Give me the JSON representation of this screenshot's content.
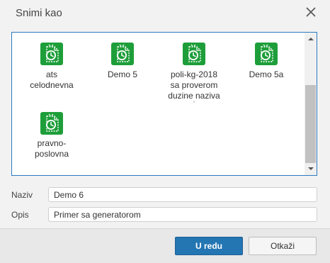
{
  "dialog": {
    "title": "Snimi kao",
    "close_icon": "close-icon"
  },
  "files": [
    {
      "name_lines": [
        "ats",
        "celodnevna"
      ],
      "icon": "schedule-document-icon"
    },
    {
      "name_lines": [
        "Demo 5"
      ],
      "icon": "schedule-document-icon"
    },
    {
      "name_lines": [
        "poli-kg-2018",
        "sa proverom",
        "duzine naziva",
        "'"
      ],
      "icon": "schedule-document-icon"
    },
    {
      "name_lines": [
        "Demo 5a"
      ],
      "icon": "schedule-document-icon"
    },
    {
      "name_lines": [
        "pravno-",
        "poslovna"
      ],
      "icon": "schedule-document-icon"
    }
  ],
  "form": {
    "name_label": "Naziv",
    "name_value": "Demo 6",
    "desc_label": "Opis",
    "desc_value": "Primer sa generatorom"
  },
  "buttons": {
    "ok": "U redu",
    "cancel": "Otkaži"
  },
  "colors": {
    "accent": "#2476b3",
    "icon_green": "#1e9e3a"
  }
}
